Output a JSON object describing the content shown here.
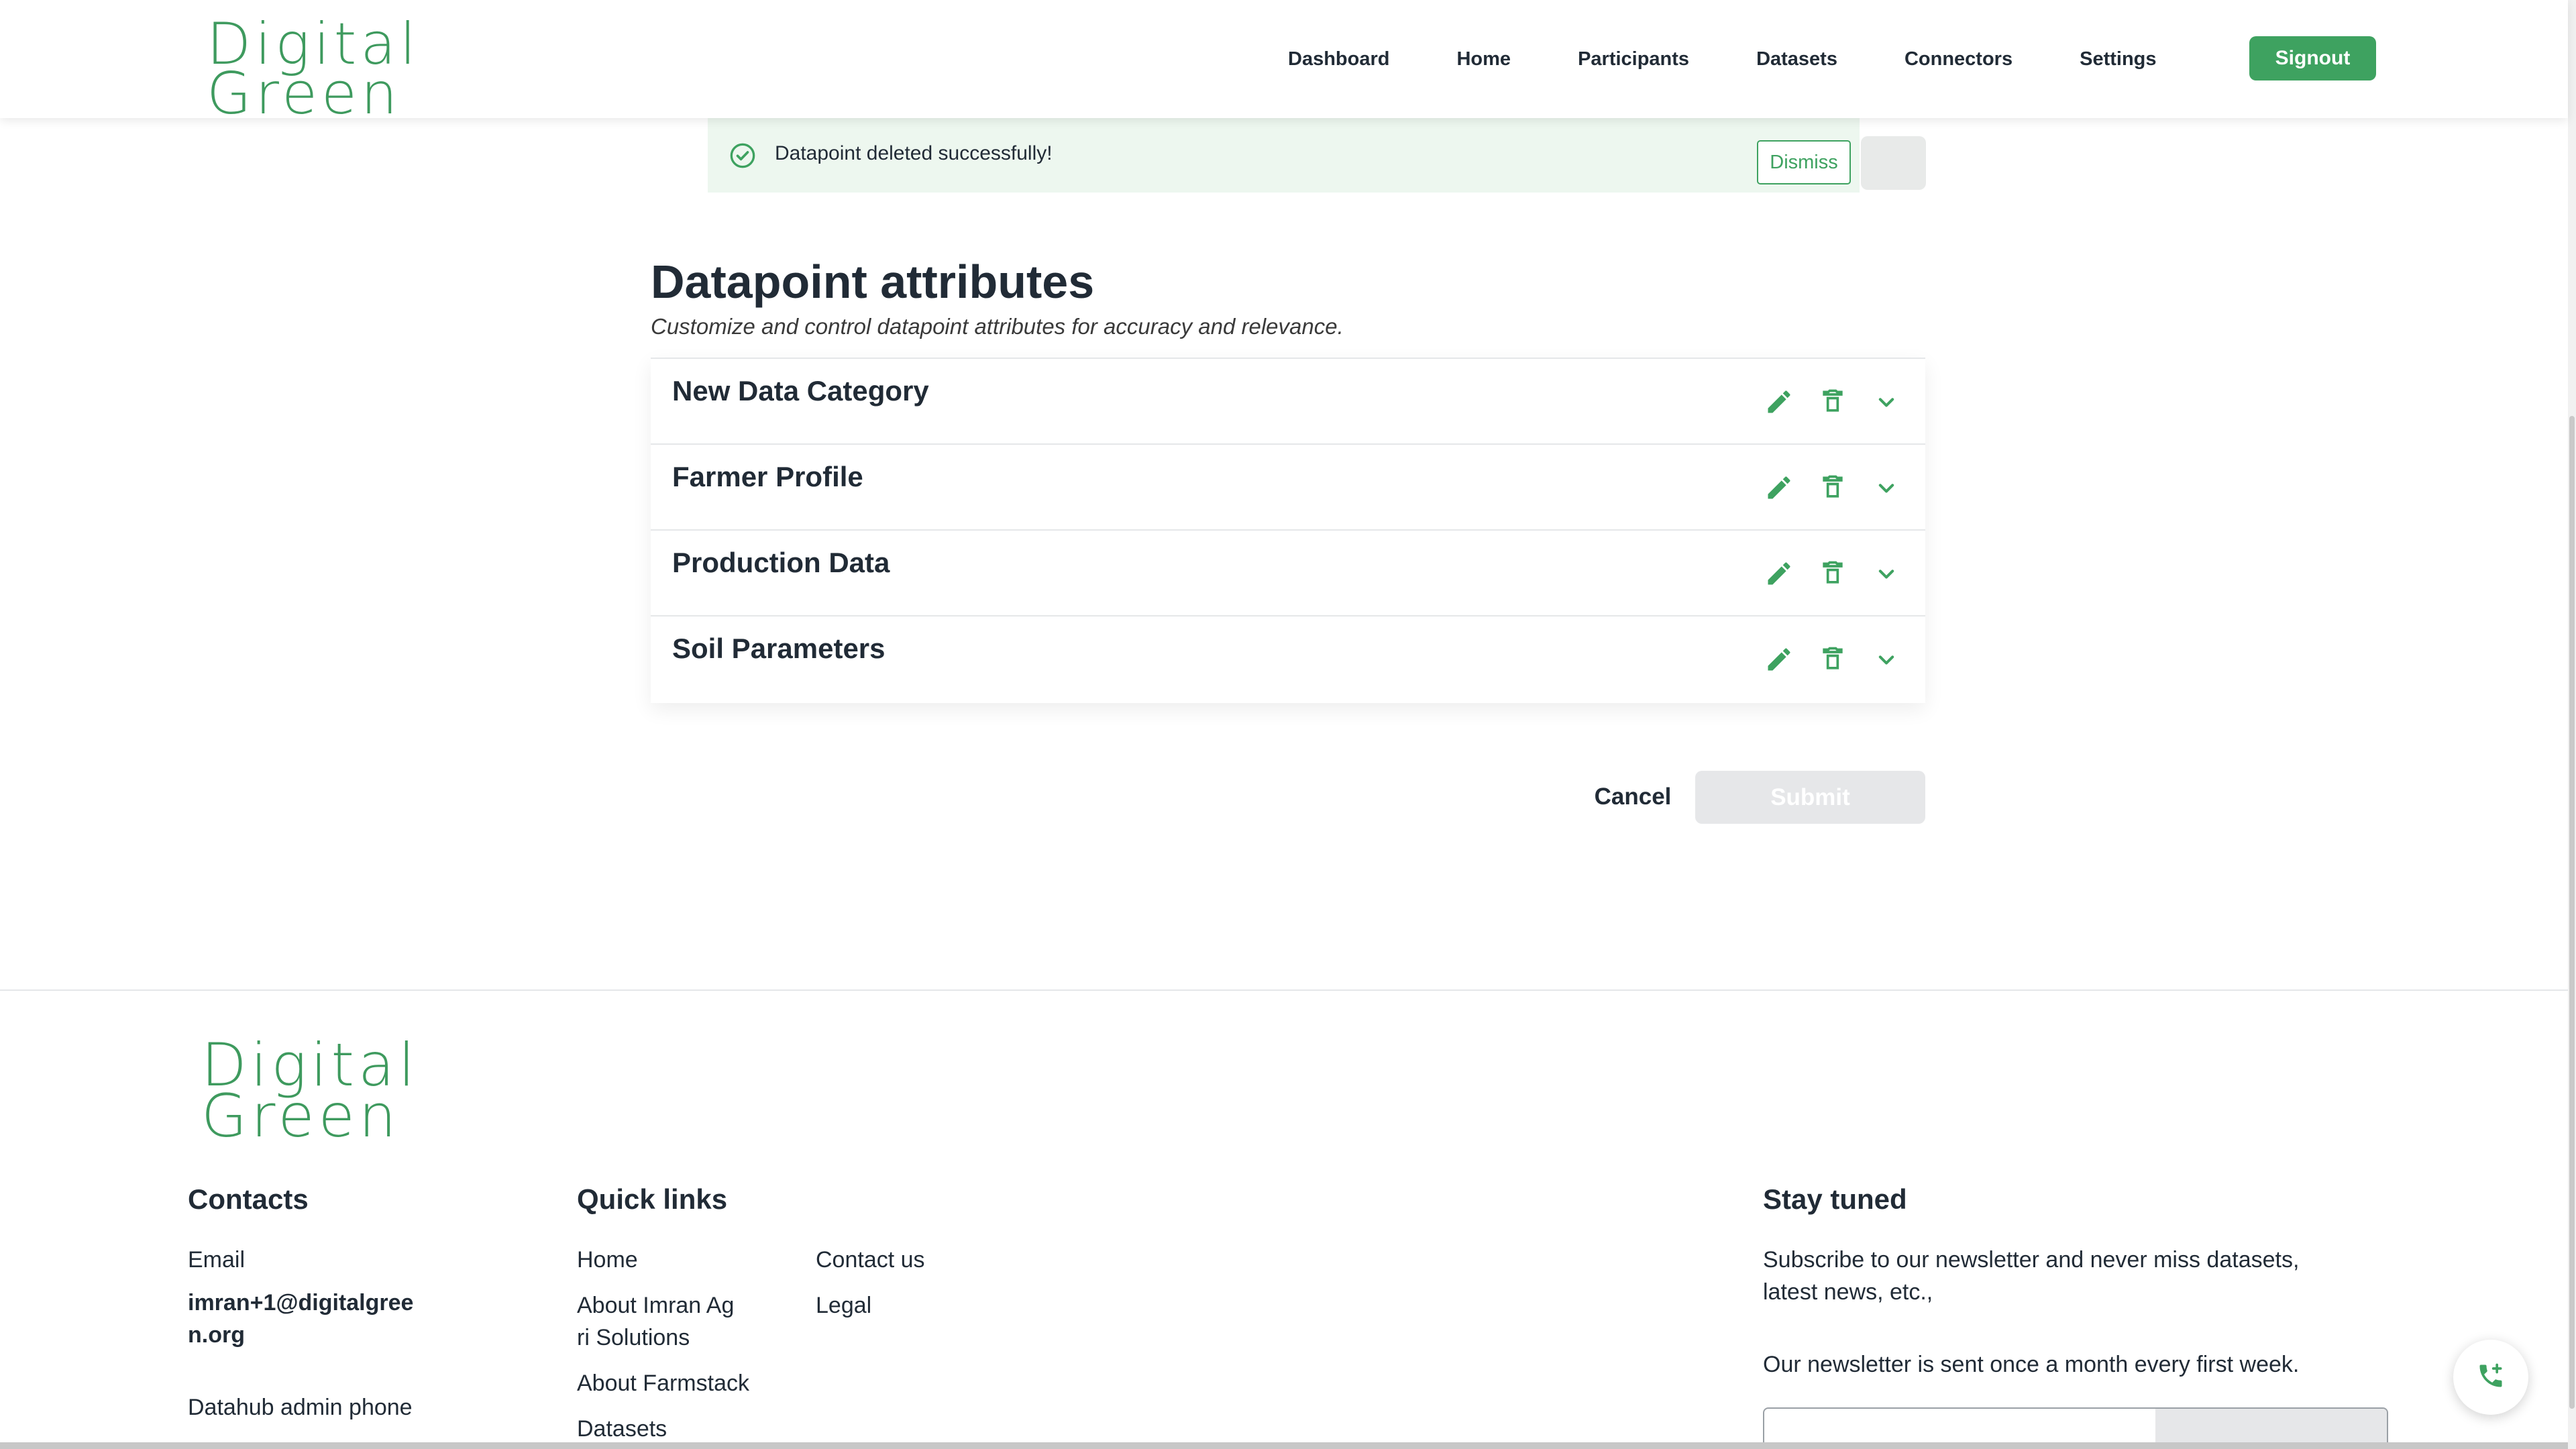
{
  "brand": {
    "logo_line1": "Digital",
    "logo_line2": "Green",
    "accent": "#3ea260"
  },
  "nav": {
    "items": [
      "Dashboard",
      "Home",
      "Participants",
      "Datasets",
      "Connectors",
      "Settings"
    ],
    "signout_label": "Signout"
  },
  "alert": {
    "message": "Datapoint deleted successfully!",
    "dismiss_label": "Dismiss",
    "icon": "check-circle-icon"
  },
  "page": {
    "title": "Datapoint attributes",
    "subtitle": "Customize and control datapoint attributes for accuracy and relevance."
  },
  "categories": [
    {
      "label": "New Data Category"
    },
    {
      "label": "Farmer Profile"
    },
    {
      "label": "Production Data"
    },
    {
      "label": "Soil Parameters"
    }
  ],
  "actions": {
    "cancel_label": "Cancel",
    "submit_label": "Submit"
  },
  "footer": {
    "logo_line1": "Digital",
    "logo_line2": "Green",
    "contacts": {
      "heading": "Contacts",
      "email_label": "Email",
      "email_value_line1": "imran+1@digitalgree",
      "email_value_line2": "n.org",
      "phone_label": "Datahub admin phone"
    },
    "quick_links": {
      "heading": "Quick links",
      "col1": [
        "Home",
        "About Imran Ag",
        "ri Solutions",
        "About Farmstack",
        "Datasets"
      ],
      "col2": [
        "Contact us",
        "Legal"
      ]
    },
    "stay_tuned": {
      "heading": "Stay tuned",
      "line1": "Subscribe to our newsletter and never miss datasets,",
      "line2": "latest news, etc.,",
      "line3": "Our newsletter is sent once a month every first week."
    }
  }
}
